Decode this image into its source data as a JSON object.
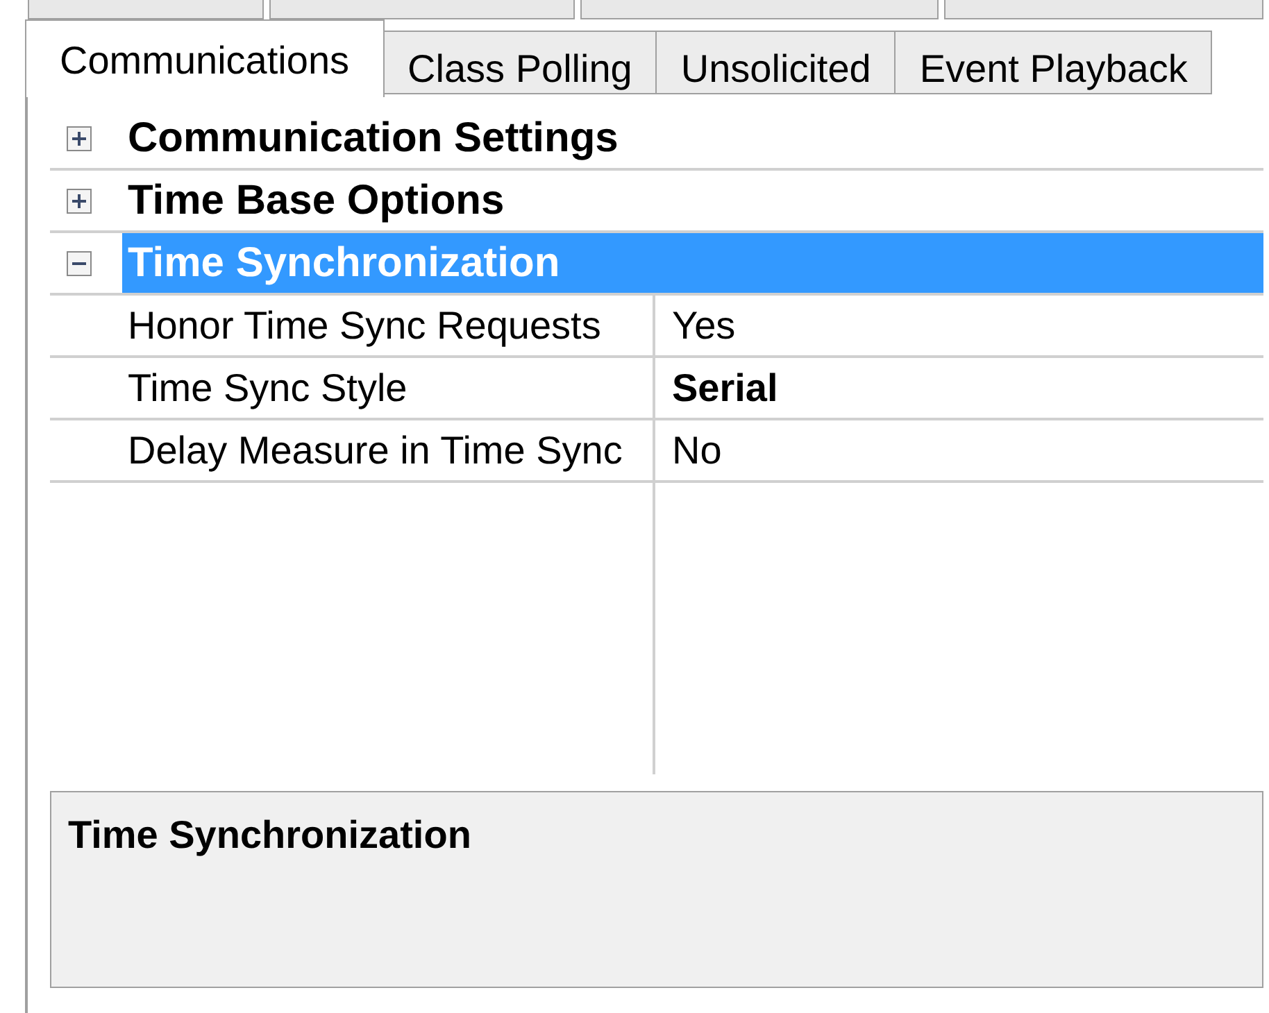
{
  "tabs": [
    {
      "label": "Communications",
      "selected": true
    },
    {
      "label": "Class Polling",
      "selected": false
    },
    {
      "label": "Unsolicited",
      "selected": false
    },
    {
      "label": "Event Playback",
      "selected": false
    }
  ],
  "property_grid": {
    "categories": [
      {
        "label": "Communication Settings",
        "expanded": false,
        "selected": false
      },
      {
        "label": "Time Base Options",
        "expanded": false,
        "selected": false
      },
      {
        "label": "Time Synchronization",
        "expanded": true,
        "selected": true,
        "properties": [
          {
            "name": "Honor Time Sync Requests",
            "value": "Yes",
            "modified": false
          },
          {
            "name": "Time Sync Style",
            "value": "Serial",
            "modified": true
          },
          {
            "name": "Delay Measure in Time Sync",
            "value": "No",
            "modified": false
          }
        ]
      }
    ]
  },
  "description": {
    "title": "Time Synchronization"
  }
}
